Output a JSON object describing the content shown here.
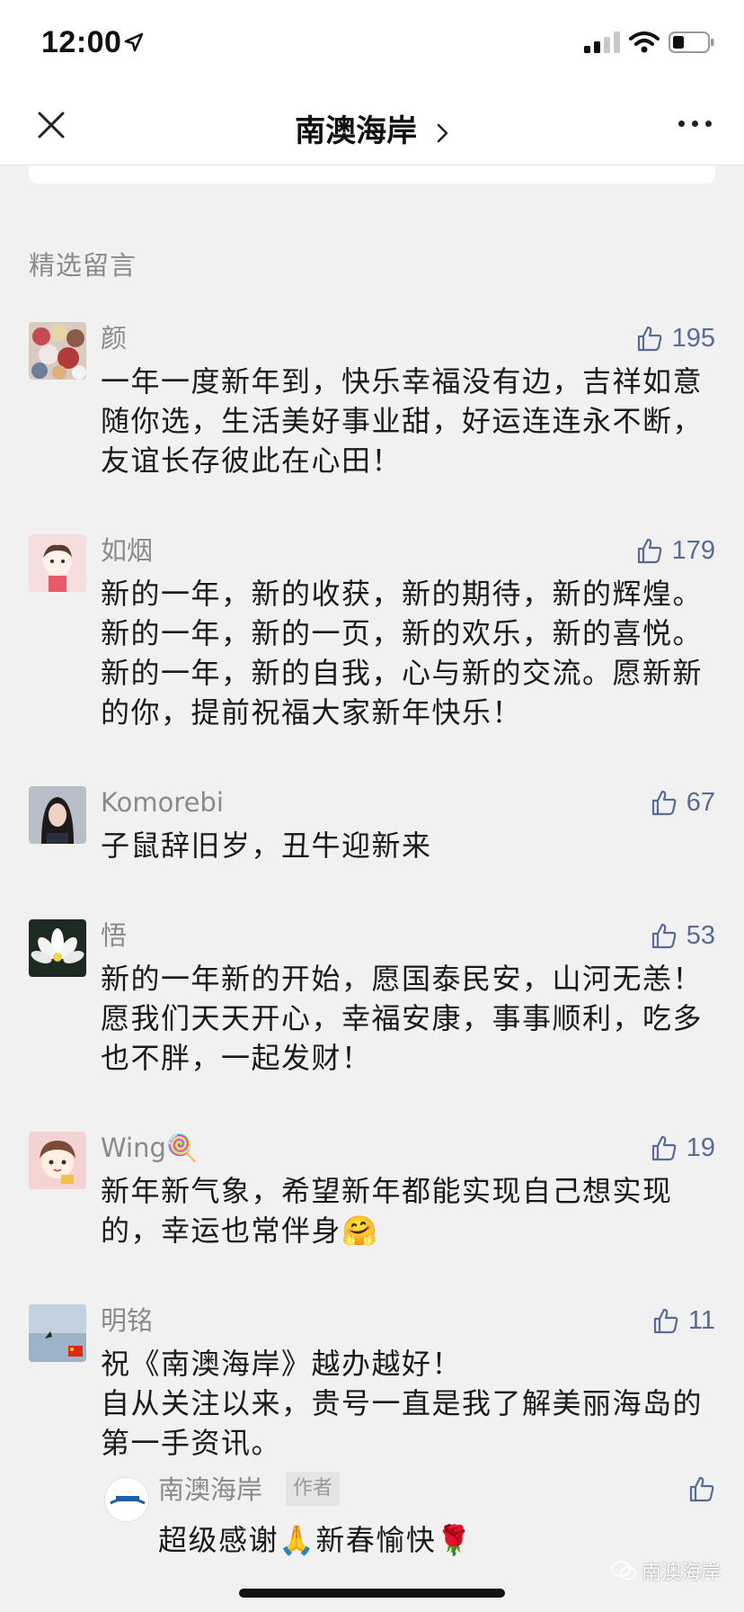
{
  "status_bar": {
    "time": "12:00"
  },
  "nav": {
    "title": "南澳海岸"
  },
  "section_title": "精选留言",
  "comments": [
    {
      "name": "颜",
      "likes": "195",
      "text": "一年一度新年到，快乐幸福没有边，吉祥如意随你选，生活美好事业甜，好运连连永不断，友谊长存彼此在心田！"
    },
    {
      "name": "如烟",
      "likes": "179",
      "text": "新的一年，新的收获，新的期待，新的辉煌。新的一年，新的一页，新的欢乐，新的喜悦。新的一年，新的自我，心与新的交流。愿新新的你，提前祝福大家新年快乐！"
    },
    {
      "name": "Komorebi",
      "likes": "67",
      "text": "子鼠辞旧岁，丑牛迎新来"
    },
    {
      "name": "悟",
      "likes": "53",
      "text": "新的一年新的开始，愿国泰民安，山河无恙！愿我们天天开心，幸福安康，事事顺利，吃多也不胖，一起发财！"
    },
    {
      "name": "Wing🍭",
      "likes": "19",
      "text": "新年新气象，希望新年都能实现自己想实现的，幸运也常伴身🤗"
    },
    {
      "name": "明铭",
      "likes": "11",
      "text_line1": "祝《南澳海岸》越办越好！",
      "text_line2": "自从关注以来，贵号一直是我了解美丽海岛的第一手资讯。"
    }
  ],
  "reply": {
    "name": "南澳海岸",
    "badge": "作者",
    "text": "超级感谢🙏新春愉快🌹"
  },
  "watermark": "南澳海岸",
  "icons": {
    "location": "location-arrow-icon",
    "signal": "signal-icon",
    "wifi": "wifi-icon",
    "battery": "battery-icon",
    "close": "close-icon",
    "more": "more-icon",
    "like": "thumbs-up-icon"
  },
  "colors": {
    "like": "#576b95",
    "name": "#8a8a8a",
    "background": "#f1f1f1"
  }
}
